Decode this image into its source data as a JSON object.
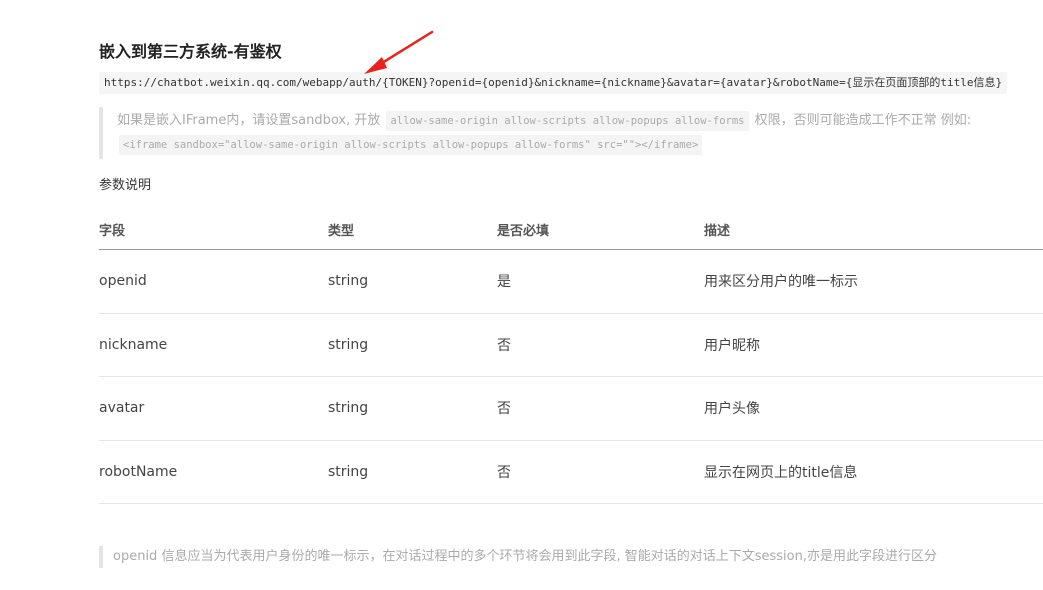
{
  "heading": "嵌入到第三方系统-有鉴权",
  "url": "https://chatbot.weixin.qq.com/webapp/auth/{TOKEN}?openid={openid}&nickname={nickname}&avatar={avatar}&robotName={显示在页面顶部的title信息}",
  "quote": {
    "prefix": "如果是嵌入IFrame内，请设置sandbox, 开放",
    "code1": "allow-same-origin allow-scripts allow-popups allow-forms",
    "suffix": "权限，否则可能造成工作不正常 例如:",
    "code2": "<iframe sandbox=\"allow-same-origin allow-scripts allow-popups allow-forms\" src=\"\"></iframe>"
  },
  "params_title": "参数说明",
  "table": {
    "headers": [
      "字段",
      "类型",
      "是否必填",
      "描述"
    ],
    "rows": [
      [
        "openid",
        "string",
        "是",
        "用来区分用户的唯一标示"
      ],
      [
        "nickname",
        "string",
        "否",
        "用户昵称"
      ],
      [
        "avatar",
        "string",
        "否",
        "用户头像"
      ],
      [
        "robotName",
        "string",
        "否",
        "显示在网页上的title信息"
      ]
    ]
  },
  "note": "openid 信息应当为代表用户身份的唯一标示，在对话过程中的多个环节将会用到此字段, 智能对话的对话上下文session,亦是用此字段进行区分",
  "colors": {
    "arrow": "#e8221c",
    "muted_text": "#aaaaaa",
    "code_bg": "#f5f5f5"
  },
  "icons": {
    "annotation": "red-arrow-icon"
  }
}
